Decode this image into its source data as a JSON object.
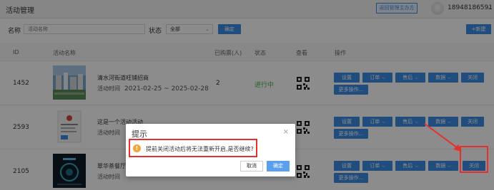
{
  "header": {
    "title": "活动管理",
    "back_label": "返回管理主办方",
    "phone": "18948186591",
    "caret": "⌄"
  },
  "filter": {
    "name_label": "名称",
    "name_placeholder": "活动名称",
    "status_label": "状态",
    "status_value": "全部",
    "confirm_label": "确定",
    "add_label": "+新建"
  },
  "table": {
    "columns": [
      "ID",
      "活动名称",
      "已购票(人)",
      "状态",
      "查看",
      "操作"
    ],
    "rows": [
      {
        "id": "1452",
        "name": "清水河街道旺铺招商",
        "time_label": "活动时间",
        "time_value": "2021-02-25 ~ 2025-02-28",
        "count": "2",
        "status": "进行中"
      },
      {
        "id": "2593",
        "name": "这是一个活动活动",
        "time_label": "活动时间",
        "time_value": "",
        "count": "",
        "status": ""
      },
      {
        "id": "2105",
        "name": "翠华茶餐厅",
        "time_label": "活动时间",
        "time_value": "",
        "count": "",
        "status": ""
      }
    ],
    "ops": {
      "settings": "设置",
      "order": "订单",
      "aftersale": "售后",
      "data": "数据",
      "close": "关闭",
      "more": "更多操作..."
    }
  },
  "dialog": {
    "title": "提示",
    "close_symbol": "×",
    "warn_symbol": "!",
    "message": "提前关闭活动后将无法重新开启,是否继续?",
    "cancel_label": "取消",
    "ok_label": "确定"
  },
  "colors": {
    "primary": "#3d8de6",
    "highlight": "#e53030",
    "status_green": "#43b14a",
    "warn": "#f0a43c"
  }
}
